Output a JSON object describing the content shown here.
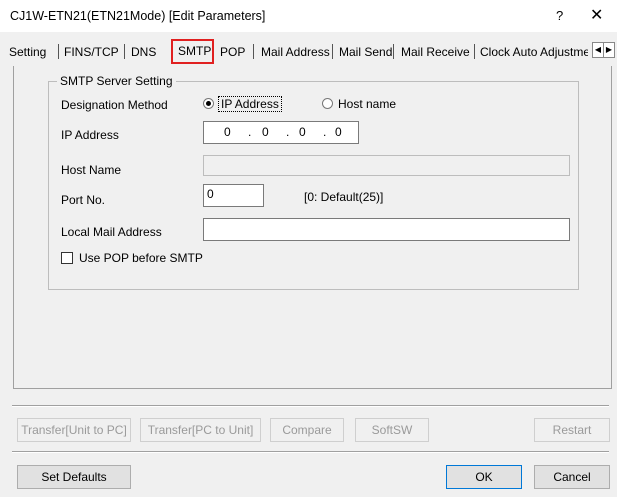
{
  "window": {
    "title": "CJ1W-ETN21(ETN21Mode) [Edit Parameters]",
    "help": "?",
    "close": "✕"
  },
  "tabs": [
    "Setting",
    "FINS/TCP",
    "DNS",
    "SMTP",
    "POP",
    "Mail Address",
    "Mail Send",
    "Mail Receive",
    "Clock Auto Adjustme"
  ],
  "active_tab": "SMTP",
  "scroll": {
    "left": "◀",
    "right": "▶"
  },
  "smtp": {
    "group_title": "SMTP Server Setting",
    "designation_label": "Designation Method",
    "opt_ip": "IP Address",
    "opt_host": "Host name",
    "selected": "IP Address",
    "ip_label": "IP Address",
    "ip_value": [
      "0",
      "0",
      "0",
      "0"
    ],
    "host_label": "Host Name",
    "host_value": "",
    "port_label": "Port No.",
    "port_value": "0",
    "port_hint": "[0: Default(25)]",
    "mail_label": "Local Mail Address",
    "mail_value": "",
    "pop_before": "Use POP before SMTP",
    "pop_before_checked": false
  },
  "actions": {
    "transfer_unit_pc": "Transfer[Unit to PC]",
    "transfer_pc_unit": "Transfer[PC to Unit]",
    "compare": "Compare",
    "softsw": "SoftSW",
    "restart": "Restart"
  },
  "footer": {
    "defaults": "Set Defaults",
    "ok": "OK",
    "cancel": "Cancel"
  }
}
